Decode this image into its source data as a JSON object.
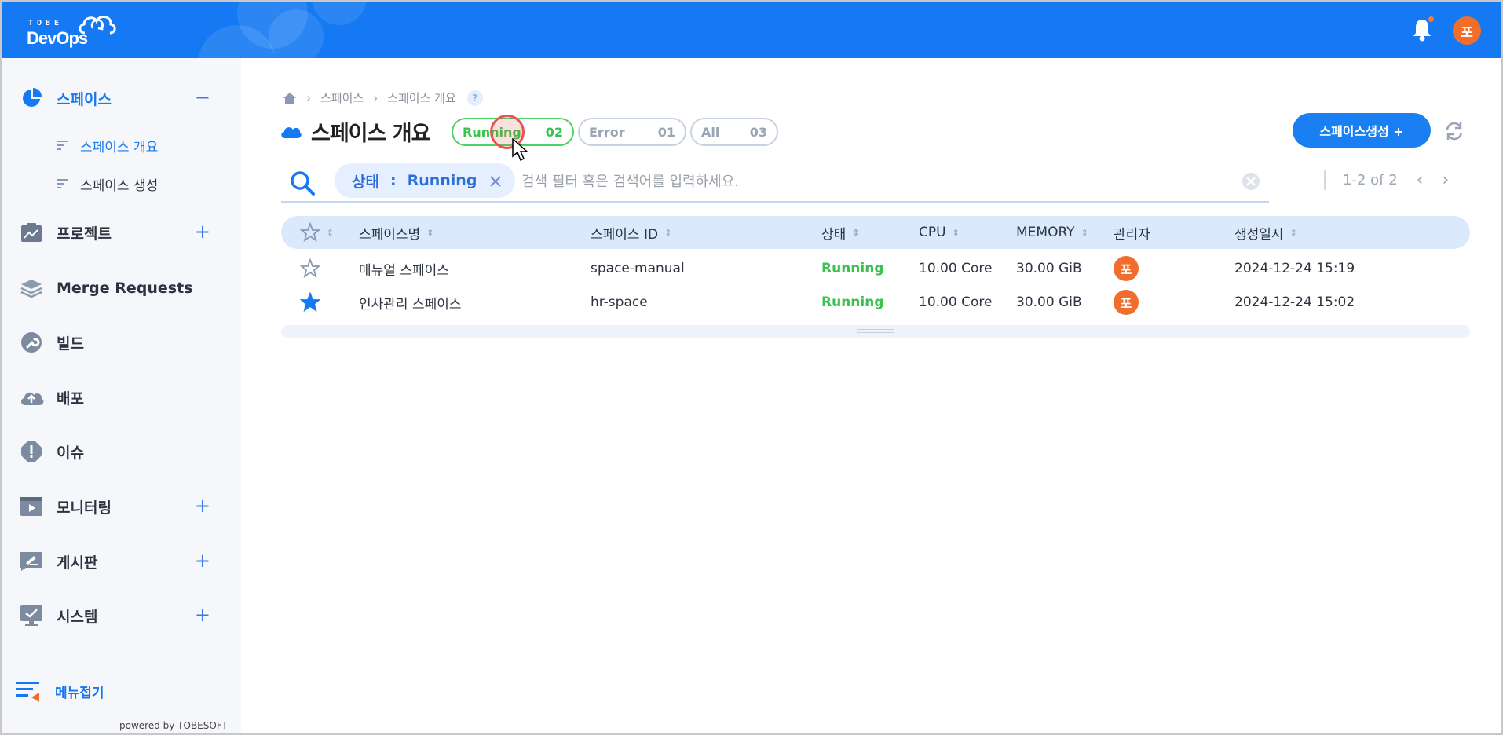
{
  "header": {
    "logo_small": "TOBE",
    "logo_main": "DevOps",
    "user_initial": "포"
  },
  "sidebar": {
    "items": [
      {
        "label": "스페이스",
        "toggle": "−",
        "icon": "pie-chart-icon"
      },
      {
        "label": "프로젝트",
        "toggle": "+",
        "icon": "project-chart-icon"
      },
      {
        "label": "Merge Requests",
        "toggle": "",
        "icon": "layers-icon"
      },
      {
        "label": "빌드",
        "toggle": "",
        "icon": "wrench-icon"
      },
      {
        "label": "배포",
        "toggle": "",
        "icon": "cloud-upload-icon"
      },
      {
        "label": "이슈",
        "toggle": "",
        "icon": "alert-icon"
      },
      {
        "label": "모니터링",
        "toggle": "+",
        "icon": "monitor-play-icon"
      },
      {
        "label": "게시판",
        "toggle": "+",
        "icon": "board-pen-icon"
      },
      {
        "label": "시스템",
        "toggle": "+",
        "icon": "system-check-icon"
      }
    ],
    "sub_items": [
      "스페이스 개요",
      "스페이스 생성"
    ],
    "collapse_label": "메뉴접기",
    "powered_by": "powered by TOBESOFT"
  },
  "breadcrumb": {
    "items": [
      "스페이스",
      "스페이스 개요"
    ],
    "help": "?"
  },
  "page": {
    "title": "스페이스 개요"
  },
  "status_pills": [
    {
      "label": "Running",
      "count": "02"
    },
    {
      "label": "Error",
      "count": "01"
    },
    {
      "label": "All",
      "count": "03"
    }
  ],
  "actions": {
    "create_label": "스페이스생성 +"
  },
  "search": {
    "chip_key": "상태",
    "chip_sep": ":",
    "chip_value": "Running",
    "placeholder": "검색 필터 혹은 검색어를 입력하세요."
  },
  "pager": {
    "range": "1-2 of 2"
  },
  "table": {
    "columns": [
      "스페이스명",
      "스페이스 ID",
      "상태",
      "CPU",
      "MEMORY",
      "관리자",
      "생성일시"
    ],
    "rows": [
      {
        "starred": false,
        "name": "매뉴얼 스페이스",
        "id": "space-manual",
        "status": "Running",
        "cpu": "10.00 Core",
        "memory": "30.00 GiB",
        "manager": "포",
        "created": "2024-12-24 15:19"
      },
      {
        "starred": true,
        "name": "인사관리 스페이스",
        "id": "hr-space",
        "status": "Running",
        "cpu": "10.00 Core",
        "memory": "30.00 GiB",
        "manager": "포",
        "created": "2024-12-24 15:02"
      }
    ]
  },
  "colors": {
    "brand": "#1479f2",
    "running": "#39c24d",
    "avatar": "#f06d2c"
  }
}
